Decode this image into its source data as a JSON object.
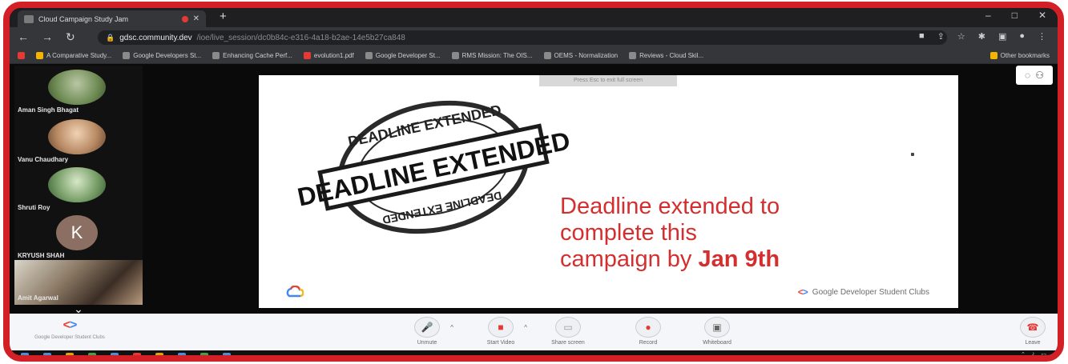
{
  "browser": {
    "tab_title": "Cloud Campaign Study Jam",
    "new_tab": "+",
    "url_host": "gdsc.community.dev",
    "url_path": "/ioe/live_session/dc0b84c-e316-4a18-b2ae-14e5b27ca848",
    "bookmarks": [
      "A Comparative Study...",
      "Google Developers St...",
      "Enhancing Cache Perf...",
      "evolution1.pdf",
      "Google Developer St...",
      "RMS Mission: The OIS...",
      "OEMS - Normalization",
      "Reviews - Cloud Skil...",
      "Other bookmarks"
    ]
  },
  "participants": [
    {
      "name": "Aman Singh Bhagat",
      "avatar": "photo"
    },
    {
      "name": "Vanu Chaudhary",
      "avatar": "photo"
    },
    {
      "name": "Shruti Roy",
      "avatar": "photo"
    },
    {
      "name": "KRYUSH SHAH",
      "avatar": "K"
    },
    {
      "name": "Amit Agarwal",
      "avatar": "video"
    }
  ],
  "slide": {
    "tip": "Press Esc to exit full screen",
    "stamp_text": "DEADLINE EXTENDED",
    "line1": "Deadline extended to",
    "line2": "complete this",
    "line3_prefix": "campaign by ",
    "line3_bold": "Jan 9th",
    "footer": "Google Developer Student Clubs"
  },
  "controls": {
    "brand_caption": "Google Developer Student Clubs",
    "unmute": "Unmute",
    "start_video": "Start Video",
    "share_screen": "Share screen",
    "record": "Record",
    "whiteboard": "Whiteboard",
    "leave": "Leave"
  },
  "colors": {
    "frame": "#d32026",
    "slide_text": "#d32f2f",
    "gdsc_blue": "#4285f4",
    "gdsc_green": "#34a853",
    "gdsc_red": "#ea4335"
  }
}
